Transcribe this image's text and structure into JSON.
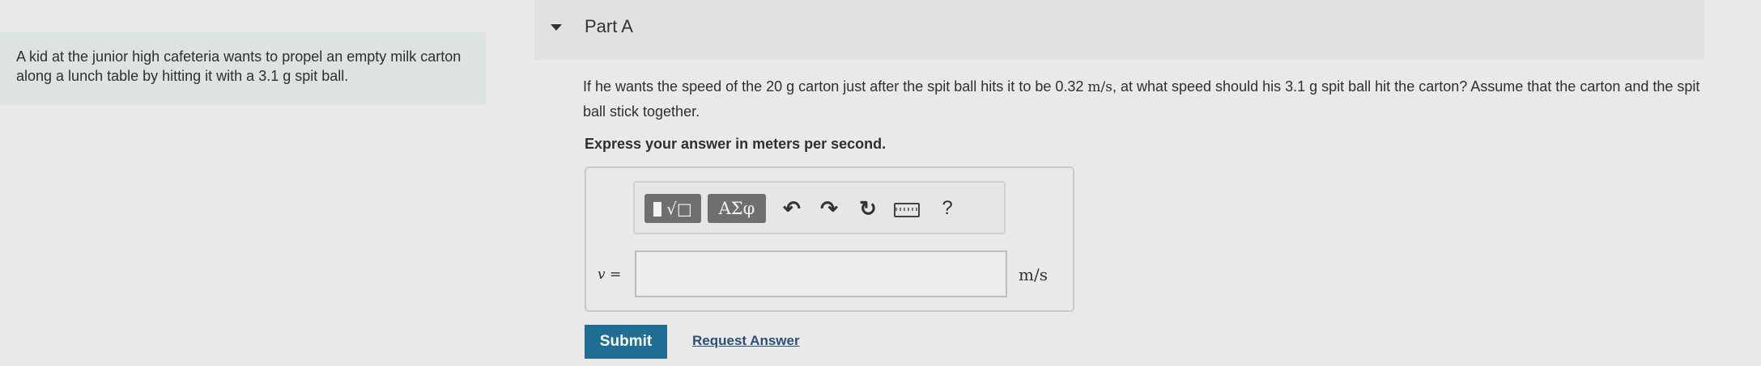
{
  "problem": {
    "text": "A kid at the junior high cafeteria wants to propel an empty milk carton along a lunch table by hitting it with a 3.1 g spit ball."
  },
  "part": {
    "title": "Part A",
    "question_pre": "If he wants the speed of the 20 g carton just after the spit ball hits it to be 0.32 ",
    "question_unit": "m/s",
    "question_post": ", at what speed should his 3.1 g spit ball hit the carton? Assume that the carton and the spit ball stick together.",
    "instruction": "Express your answer in meters per second."
  },
  "toolbar": {
    "greek_label": "ΑΣφ",
    "templates_label": "√□",
    "undo_icon": "↶",
    "redo_icon": "↷",
    "reset_icon": "↻",
    "help_label": "?"
  },
  "answer": {
    "variable_label": "v =",
    "value": "",
    "unit": "m/s"
  },
  "actions": {
    "submit_label": "Submit",
    "request_label": "Request Answer"
  },
  "colors": {
    "submit_bg": "#1f6f95",
    "link": "#2b4f7a",
    "toolbar_btn": "#6f6f6f"
  }
}
